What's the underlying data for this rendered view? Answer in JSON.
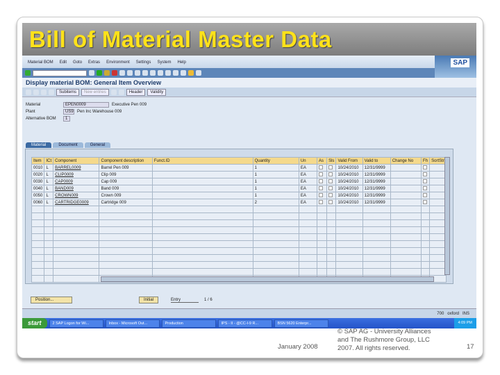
{
  "slide": {
    "title": "Bill of Material Master Data",
    "date": "January 2008",
    "copyright": [
      "© SAP AG - University Alliances",
      "and The Rushmore Group, LLC",
      "2007. All rights reserved."
    ],
    "page": "17"
  },
  "menu": [
    "Material BOM",
    "Edit",
    "Goto",
    "Extras",
    "Environment",
    "Settings",
    "System",
    "Help"
  ],
  "logo": "SAP",
  "screen_title": "Display material BOM: General Item Overview",
  "app_toolbar": {
    "subitems": "Subitems",
    "new_entries": "New entries",
    "header": "Header",
    "validity": "Validity"
  },
  "fields": {
    "material_label": "Material",
    "material": "EPEN0009",
    "material_desc": "Executive Pen 009",
    "plant_label": "Plant",
    "plant": "US9",
    "plant_desc": "Pen Inc Warehouse 009",
    "altbom_label": "Alternative BOM",
    "altbom": "1"
  },
  "tabs": [
    "Material",
    "Document",
    "General"
  ],
  "columns": [
    "Item",
    "ICt",
    "Component",
    "Component description",
    "Funct.ID",
    "Quantity",
    "Un",
    "As",
    "Sls",
    "Valid From",
    "Valid to",
    "Change No",
    "Fh",
    "SortStr"
  ],
  "rows": [
    {
      "item": "0010",
      "ict": "L",
      "comp": "BARREL0009",
      "desc": "Barrel Pen 009",
      "qty": "1",
      "un": "EA",
      "from": "10/24/2010",
      "to": "12/31/9999"
    },
    {
      "item": "0020",
      "ict": "L",
      "comp": "CLIP0009",
      "desc": "Clip 009",
      "qty": "1",
      "un": "EA",
      "from": "10/24/2010",
      "to": "12/31/9999"
    },
    {
      "item": "0030",
      "ict": "L",
      "comp": "CAP0009",
      "desc": "Cap 009",
      "qty": "1",
      "un": "EA",
      "from": "10/24/2010",
      "to": "12/31/9999"
    },
    {
      "item": "0040",
      "ict": "L",
      "comp": "BAND009",
      "desc": "Band 009",
      "qty": "1",
      "un": "EA",
      "from": "10/24/2010",
      "to": "12/31/9999"
    },
    {
      "item": "0050",
      "ict": "L",
      "comp": "CROWN009",
      "desc": "Crown 009",
      "qty": "1",
      "un": "EA",
      "from": "10/24/2010",
      "to": "12/31/9999"
    },
    {
      "item": "0060",
      "ict": "L",
      "comp": "CARTRIDGE0009",
      "desc": "Cartridge 009",
      "qty": "2",
      "un": "EA",
      "from": "10/24/2010",
      "to": "12/31/9999"
    }
  ],
  "bottom": {
    "position": "Position...",
    "initial": "Initial",
    "entry_label": "Entry",
    "entry": "1 / 6"
  },
  "status": {
    "server": "700",
    "client": "oxford",
    "mode": "INS"
  },
  "taskbar": {
    "start": "start",
    "tasks": [
      "2 SAP Logon for Wi...",
      "Inbox - Microsoft Out...",
      "Production",
      "IPS - II - @CC-I-9 R...",
      "BSN 5620 Enterpr..."
    ],
    "time": "4:09 PM"
  }
}
